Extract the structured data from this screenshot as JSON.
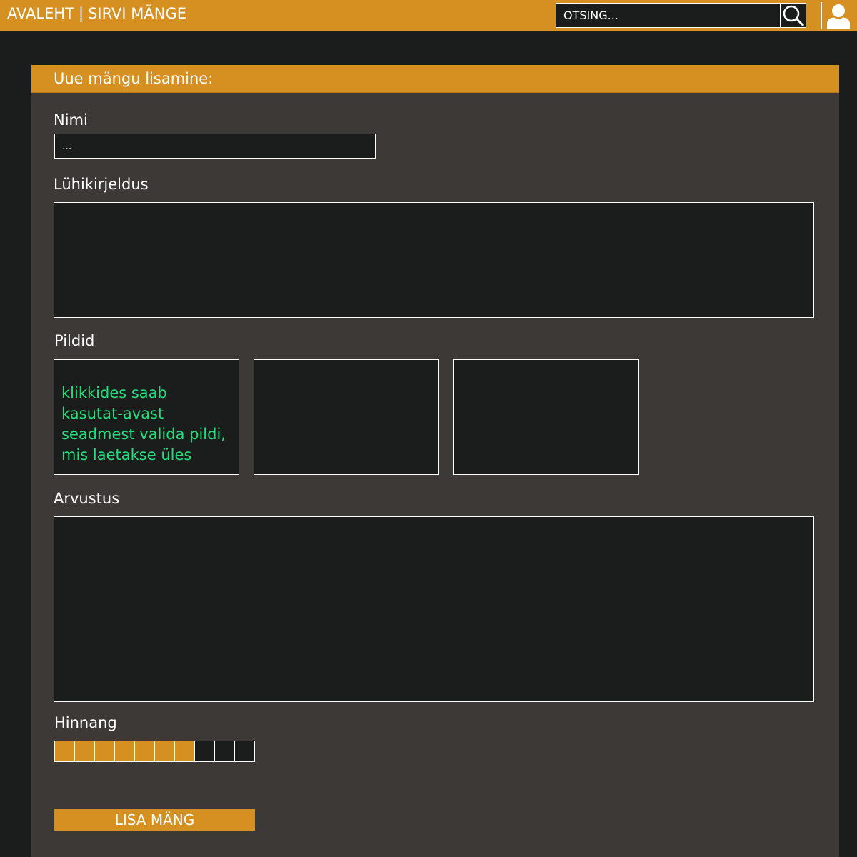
{
  "nav": {
    "home": "AVALEHT",
    "separator": "|",
    "browse": "SIRVI MÄNGE"
  },
  "search": {
    "placeholder": "OTSING...",
    "icon": "search-icon"
  },
  "user": {
    "icon": "user-icon"
  },
  "colors": {
    "accent": "#d68f21",
    "background": "#1b1c1c",
    "panel": "#3d3937",
    "hint": "#21e07c"
  },
  "form": {
    "title": "Uue mängu lisamine:",
    "name_label": "Nimi",
    "name_placeholder": "...",
    "short_desc_label": "Lühikirjeldus",
    "images_label": "Pildid",
    "image_hint": "klikkides saab kasutat-avast seadmest valida pildi, mis laetakse üles",
    "review_label": "Arvustus",
    "rating_label": "Hinnang",
    "rating": {
      "value": 7,
      "max": 10
    },
    "submit_label": "LISA MÄNG"
  }
}
